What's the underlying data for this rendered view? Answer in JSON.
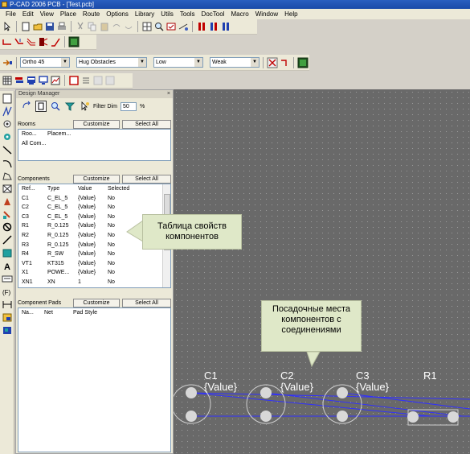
{
  "window": {
    "title": "P-CAD 2006 PCB - [Test.pcb]"
  },
  "menu": [
    "File",
    "Edit",
    "View",
    "Place",
    "Route",
    "Options",
    "Library",
    "Utils",
    "Tools",
    "DocTool",
    "Macro",
    "Window",
    "Help"
  ],
  "route_bar": {
    "mode": "Ortho 45",
    "obstacle": "Hug Obstacles",
    "level1": "Low",
    "level2": "Weak"
  },
  "design_manager": {
    "title": "Design Manager",
    "filter_label": "Filter Dim",
    "filter_value": "50",
    "filter_unit": "%",
    "rooms": {
      "label": "Rooms",
      "customize": "Customize",
      "select_all": "Select All",
      "columns": [
        "Roo...",
        "Placem..."
      ],
      "rows": [
        "All Com..."
      ]
    },
    "components": {
      "label": "Components",
      "customize": "Customize",
      "select_all": "Select All",
      "columns": [
        "Ref...",
        "Type",
        "Value",
        "Selected"
      ],
      "rows": [
        [
          "C1",
          "C_EL_5",
          "{Value}",
          "No"
        ],
        [
          "C2",
          "C_EL_5",
          "{Value}",
          "No"
        ],
        [
          "C3",
          "C_EL_5",
          "{Value}",
          "No"
        ],
        [
          "R1",
          "R_0.125",
          "{Value}",
          "No"
        ],
        [
          "R2",
          "R_0.125",
          "{Value}",
          "No"
        ],
        [
          "R3",
          "R_0.125",
          "{Value}",
          "No"
        ],
        [
          "R4",
          "R_SW",
          "{Value}",
          "No"
        ],
        [
          "VT1",
          "KT315",
          "{Value}",
          "No"
        ],
        [
          "X1",
          "POWE...",
          "{Value}",
          "No"
        ],
        [
          "XN1",
          "XN",
          "1",
          "No"
        ]
      ]
    },
    "pads": {
      "label": "Component Pads",
      "customize": "Customize",
      "select_all": "Select All",
      "columns": [
        "Na...",
        "Net",
        "Pad Style"
      ]
    }
  },
  "callouts": {
    "table": "Таблица свойств компонентов",
    "footprints": "Посадочные места компонентов с соединениями"
  },
  "canvas_components": [
    {
      "ref": "C1",
      "value": "{Value}"
    },
    {
      "ref": "C2",
      "value": "{Value}"
    },
    {
      "ref": "C3",
      "value": "{Value}"
    },
    {
      "ref": "R1",
      "value": ""
    }
  ],
  "colors": {
    "canvas": "#696969",
    "net": "#3030ff",
    "callout": "#dfe8c8"
  }
}
